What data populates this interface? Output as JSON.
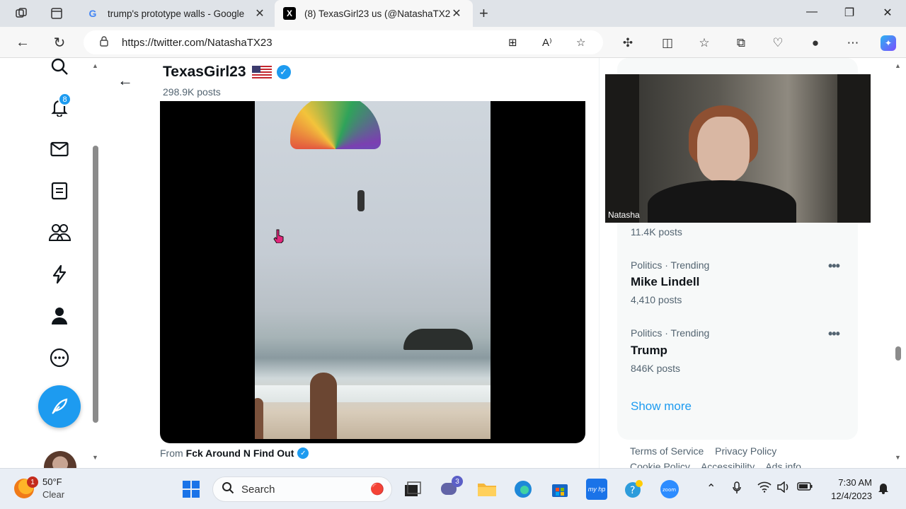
{
  "browser": {
    "tabs": [
      {
        "title": "trump's prototype walls - Google",
        "favicon": "google-g-icon",
        "active": false
      },
      {
        "title": "(8) TexasGirl23 us (@NatashaTX2",
        "favicon": "x-logo-icon",
        "active": true
      }
    ],
    "url": "https://twitter.com/NatashaTX23"
  },
  "profile": {
    "name": "TexasGirl23",
    "posts": "298.9K posts"
  },
  "nav": {
    "notifications_badge": "8"
  },
  "tweet": {
    "from_prefix": "From",
    "from_source": "Fck Around N Find Out"
  },
  "trends": {
    "top_count": "11.4K posts",
    "items": [
      {
        "meta": "Politics · Trending",
        "name": "Mike Lindell",
        "count": "4,410 posts"
      },
      {
        "meta": "Politics · Trending",
        "name": "Trump",
        "count": "846K posts"
      }
    ],
    "show_more": "Show more"
  },
  "footer": {
    "links": [
      "Terms of Service",
      "Privacy Policy",
      "Cookie Policy",
      "Accessibility",
      "Ads info"
    ]
  },
  "webcam": {
    "name": "Natasha"
  },
  "taskbar": {
    "weather_temp": "50°F",
    "weather_desc": "Clear",
    "weather_badge": "1",
    "search_label": "Search",
    "teams_badge": "3",
    "time": "7:30 AM",
    "date": "12/4/2023"
  },
  "colors": {
    "accent": "#1d9bf0",
    "text_secondary": "#536471"
  }
}
